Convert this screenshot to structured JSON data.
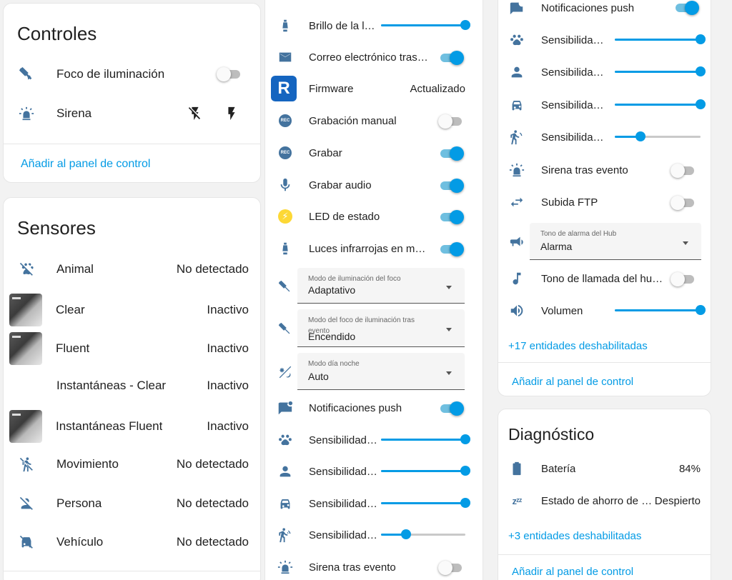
{
  "col1": {
    "controles": {
      "title": "Controles",
      "rows": [
        {
          "label": "Foco de iluminación",
          "icon": "spotlight-icon",
          "state": "off"
        },
        {
          "label": "Sirena",
          "icon": "siren-icon"
        }
      ],
      "add_link": "Añadir al panel de control"
    },
    "sensores": {
      "title": "Sensores",
      "rows": [
        {
          "label": "Animal",
          "value": "No detectado",
          "icon": "paw-off-icon"
        },
        {
          "label": "Clear",
          "value": "Inactivo",
          "icon": "camera-thumbnail"
        },
        {
          "label": "Fluent",
          "value": "Inactivo",
          "icon": "camera-thumbnail"
        },
        {
          "label": "Instantáneas - Clear",
          "value": "Inactivo",
          "icon": "none"
        },
        {
          "label": "Instantáneas Fluent",
          "value": "Inactivo",
          "icon": "camera-thumbnail"
        },
        {
          "label": "Movimiento",
          "value": "No detectado",
          "icon": "motion-sensor-off-icon"
        },
        {
          "label": "Persona",
          "value": "No detectado",
          "icon": "account-off-icon"
        },
        {
          "label": "Vehículo",
          "value": "No detectado",
          "icon": "car-off-icon"
        }
      ]
    }
  },
  "col2": {
    "rows": [
      {
        "label": "Brillo de la luz...",
        "type": "slider",
        "level": 1.0
      },
      {
        "label": "Correo electrónico tras eve...",
        "type": "toggle",
        "state": "on"
      },
      {
        "label": "Firmware",
        "type": "value",
        "value": "Actualizado"
      },
      {
        "label": "Grabación manual",
        "type": "toggle",
        "state": "off"
      },
      {
        "label": "Grabar",
        "type": "toggle",
        "state": "on"
      },
      {
        "label": "Grabar audio",
        "type": "toggle",
        "state": "on"
      },
      {
        "label": "LED de estado",
        "type": "toggle",
        "state": "on"
      },
      {
        "label": "Luces infrarrojas en modo ...",
        "type": "toggle",
        "state": "on"
      }
    ],
    "selects": [
      {
        "label": "Modo de iluminación del foco",
        "value": "Adaptativo"
      },
      {
        "label_line1": "Modo del foco de iluminación tras",
        "label_line2": "evento",
        "value": "Encendido"
      },
      {
        "label": "Modo día noche",
        "value": "Auto"
      }
    ],
    "rows2": [
      {
        "label": "Notificaciones push",
        "type": "toggle",
        "state": "on"
      },
      {
        "label": "Sensibilidad d...",
        "type": "slider",
        "level": 1.0
      },
      {
        "label": "Sensibilidad d...",
        "type": "slider",
        "level": 1.0
      },
      {
        "label": "Sensibilidad d...",
        "type": "slider",
        "level": 1.0
      },
      {
        "label": "Sensibilidad d...",
        "type": "slider",
        "level": 0.3
      },
      {
        "label": "Sirena tras evento",
        "type": "toggle",
        "state": "off"
      }
    ]
  },
  "col3": {
    "rows": [
      {
        "label": "Notificaciones push",
        "type": "toggle",
        "state": "on"
      },
      {
        "label": "Sensibilidad d...",
        "type": "slider",
        "level": 1.0
      },
      {
        "label": "Sensibilidad d...",
        "type": "slider",
        "level": 1.0
      },
      {
        "label": "Sensibilidad d...",
        "type": "slider",
        "level": 1.0
      },
      {
        "label": "Sensibilidad d...",
        "type": "slider",
        "level": 0.3
      },
      {
        "label": "Sirena tras evento",
        "type": "toggle",
        "state": "off"
      },
      {
        "label": "Subida FTP",
        "type": "toggle",
        "state": "off"
      }
    ],
    "select": {
      "label": "Tono de alarma del Hub",
      "value": "Alarma"
    },
    "rows2": [
      {
        "label": "Tono de llamada del hub e...",
        "type": "toggle",
        "state": "off"
      },
      {
        "label": "Volumen",
        "type": "slider",
        "level": 1.0
      }
    ],
    "disabled_link": "+17 entidades deshabilitadas",
    "add_link": "Añadir al panel de control",
    "diagnostico": {
      "title": "Diagnóstico",
      "rows": [
        {
          "label": "Batería",
          "value": "84%"
        },
        {
          "label": "Estado de ahorro de ene...",
          "value": "Despierto"
        }
      ],
      "disabled_link": "+3 entidades deshabilitadas",
      "add_link": "Añadir al panel de control"
    }
  },
  "colors": {
    "accent": "#039be5",
    "icon": "#44739e"
  }
}
